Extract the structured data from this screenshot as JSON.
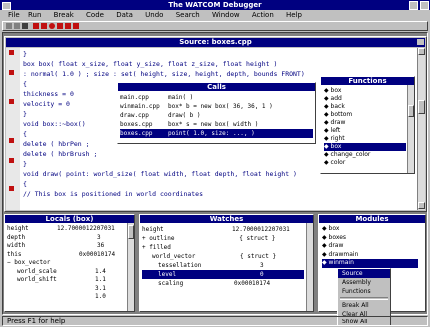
{
  "app": {
    "title": "The WATCOM Debugger"
  },
  "menubar": [
    "File",
    "Run",
    "Break",
    "Code",
    "Data",
    "Undo",
    "Search",
    "Window",
    "Action",
    "Help"
  ],
  "source": {
    "title": "Source: boxes.cpp",
    "lines": [
      "}",
      "box  box( float x_size, float y_size, float z_size, float height )",
      "    : normal( 1.0 ) ; size : set( height, size, height, depth, bounds FRONT)",
      "{",
      "    thickness = 0",
      "    velocity  = 0",
      "}",
      "void  box::~box()",
      "{",
      "    delete ( hbrPen ;",
      "    delete ( hbrBrush ;",
      "}",
      "void  draw( point: world_size( float width, float depth, float height )",
      "{",
      "    // This box is positioned in world coordinates"
    ]
  },
  "calls": {
    "title": "Calls",
    "rows": [
      [
        "main.cpp",
        "main( )"
      ],
      [
        "winmain.cpp",
        "box* b = new box( 36, 36, 1 )"
      ],
      [
        "draw.cpp",
        "draw( b )"
      ],
      [
        "boxes.cpp",
        "box* s = new box( width )"
      ],
      [
        "boxes.cpp",
        "point( 1.0, size: ..., )"
      ]
    ]
  },
  "functions": {
    "title": "Functions",
    "items": [
      "box",
      "add",
      "back",
      "bottom",
      "draw",
      "left",
      "right",
      "box",
      "change_color",
      "color"
    ]
  },
  "locals": {
    "title": "Locals (box)",
    "rows": [
      [
        "height",
        "12.7000012207031"
      ],
      [
        "depth",
        "3"
      ],
      [
        "width",
        "36"
      ],
      [
        "this",
        "0x00010174"
      ],
      [
        "box_vector",
        ""
      ],
      [
        "world_scale",
        "1.4"
      ],
      [
        "world_shift",
        "1.1"
      ],
      [
        "",
        "3.1"
      ],
      [
        "",
        "1.0"
      ]
    ]
  },
  "watches": {
    "title": "Watches",
    "rows": [
      [
        "height",
        "12.7000012207031"
      ],
      [
        "outline",
        "{ struct }"
      ],
      [
        "filled",
        ""
      ],
      [
        "world_vector",
        "{ struct }"
      ],
      [
        "tessellation",
        "3"
      ],
      [
        "level",
        "0"
      ],
      [
        "scaling",
        "0x00010174"
      ]
    ]
  },
  "modules": {
    "title": "Modules",
    "items": [
      "box",
      "boxes",
      "draw",
      "drawmain",
      "winmain"
    ]
  },
  "context_menu": {
    "items": [
      "Source",
      "Assembly",
      "Functions",
      "Break All",
      "Clear All",
      "Show All"
    ]
  },
  "status_bar": "Press F1 for help"
}
